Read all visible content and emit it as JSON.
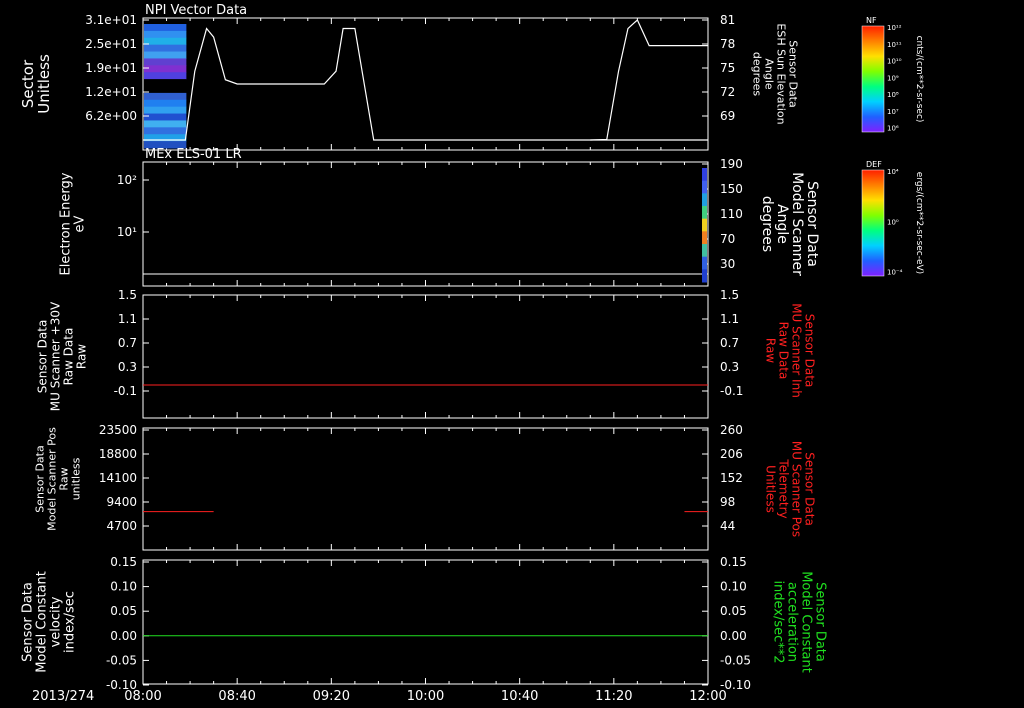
{
  "colors": {
    "background": "#000000",
    "axis": "#ffffff",
    "red_series": "#ff2020",
    "green_series": "#20e020"
  },
  "time_axis": {
    "date_label": "2013/274",
    "ticks": [
      "08:00",
      "08:40",
      "09:20",
      "10:00",
      "10:40",
      "11:20",
      "12:00"
    ]
  },
  "colorbars": [
    {
      "name": "NF",
      "unit_label": "cnts/(cm**2-sr-sec)",
      "tick_labels": [
        "10¹²",
        "10¹¹",
        "10¹⁰",
        "10⁹",
        "10⁸",
        "10⁷",
        "10⁶"
      ]
    },
    {
      "name": "DEF",
      "unit_label": "ergs/(cm**2-sr-sec-eV)",
      "tick_labels": [
        "10⁴",
        "10⁰",
        "10⁻⁴"
      ]
    }
  ],
  "chart_data": [
    {
      "type": "heatmap",
      "title": "NPI Vector Data",
      "ylabel": [
        "Sector",
        "Unitless"
      ],
      "ylim": [
        0,
        31
      ],
      "yticks": [
        "3.1e+01",
        "2.5e+01",
        "1.9e+01",
        "1.2e+01",
        "6.2e+00"
      ],
      "heatmap_extent_minutes": [
        0,
        18
      ],
      "line_series": {
        "name": "ESH Sun Elevation Angle",
        "ylabel_right": [
          "Sensor Data",
          "ESH Sun Elevation",
          "Angle",
          "degrees"
        ],
        "ylim": [
          66,
          81
        ],
        "yticks_right": [
          "81",
          "78",
          "75",
          "72",
          "69"
        ],
        "x_minutes": [
          0,
          14,
          18,
          22,
          27,
          30,
          35,
          40,
          47,
          60,
          77,
          82,
          85,
          90,
          98,
          110,
          170,
          190,
          200,
          240
        ],
        "y": [
          64,
          64,
          66,
          75,
          80,
          79,
          74,
          73.5,
          73.5,
          73.5,
          73.5,
          75,
          80,
          80,
          64,
          64,
          64,
          64,
          64,
          64
        ]
      },
      "line_series_tail": {
        "x_minutes": [
          190,
          197,
          202,
          206,
          210,
          215,
          240
        ],
        "y": [
          64,
          67,
          75,
          80,
          81,
          78,
          78
        ]
      }
    },
    {
      "type": "heatmap",
      "title": "MEx ELS-01 LR",
      "ylabel": [
        "Electron Energy",
        "eV"
      ],
      "yticks_log": [
        "10²",
        "10¹"
      ],
      "ylabel_right": [
        "Sensor Data",
        "Model Scanner",
        "Angle",
        "degrees"
      ],
      "yticks_right": [
        "190",
        "150",
        "110",
        "70",
        "30"
      ],
      "line_series": {
        "name": "Model Scanner Angle",
        "y_const": 8
      }
    },
    {
      "type": "line",
      "ylabel": [
        "Sensor Data",
        "MU Scanner +30V",
        "Raw Data",
        "Raw"
      ],
      "ylabel_right": [
        "Sensor Data",
        "MU Scanner Inh",
        "Raw Data",
        "Raw"
      ],
      "ylim": [
        -0.3,
        1.5
      ],
      "yticks": [
        "1.5",
        "1.1",
        "0.7",
        "0.3",
        "-0.1"
      ],
      "yticks_right": [
        "1.5",
        "1.1",
        "0.7",
        "0.3",
        "-0.1"
      ],
      "series": [
        {
          "name": "MU Scanner Inh",
          "color": "#ff2020",
          "x_minutes": [
            0,
            240
          ],
          "y": [
            0,
            0
          ]
        }
      ]
    },
    {
      "type": "line",
      "ylabel": [
        "Sensor Data",
        "Model Scanner Pos",
        "Raw",
        "unitless"
      ],
      "ylabel_right": [
        "Sensor Data",
        "MU Scanner Pos",
        "Telemetry",
        "Unitless"
      ],
      "ylim": [
        0,
        23500
      ],
      "yticks": [
        "23500",
        "18800",
        "14100",
        "9400",
        "4700"
      ],
      "ylim_right": [
        0,
        260
      ],
      "yticks_right": [
        "260",
        "206",
        "152",
        "98",
        "44"
      ],
      "series": [
        {
          "name": "MU Scanner Pos",
          "color": "#ff2020",
          "x_minutes": [
            0,
            30
          ],
          "y": [
            7400,
            7400
          ]
        },
        {
          "name": "MU Scanner Pos",
          "color": "#ff2020",
          "x_minutes": [
            230,
            240
          ],
          "y": [
            7400,
            7400
          ]
        }
      ]
    },
    {
      "type": "line",
      "ylabel": [
        "Sensor Data",
        "Model Constant",
        "velocity",
        "index/sec"
      ],
      "ylabel_right": [
        "Sensor Data",
        "Model Constant",
        "acceleration",
        "index/sec**2"
      ],
      "ylim": [
        -0.1,
        0.15
      ],
      "yticks": [
        "0.15",
        "0.10",
        "0.05",
        "0.00",
        "-0.05",
        "-0.10"
      ],
      "yticks_right": [
        "0.15",
        "0.10",
        "0.05",
        "0.00",
        "-0.05",
        "-0.10"
      ],
      "series": [
        {
          "name": "Model Constant acceleration",
          "color": "#20e020",
          "x_minutes": [
            0,
            240
          ],
          "y": [
            0,
            0
          ]
        }
      ]
    }
  ]
}
